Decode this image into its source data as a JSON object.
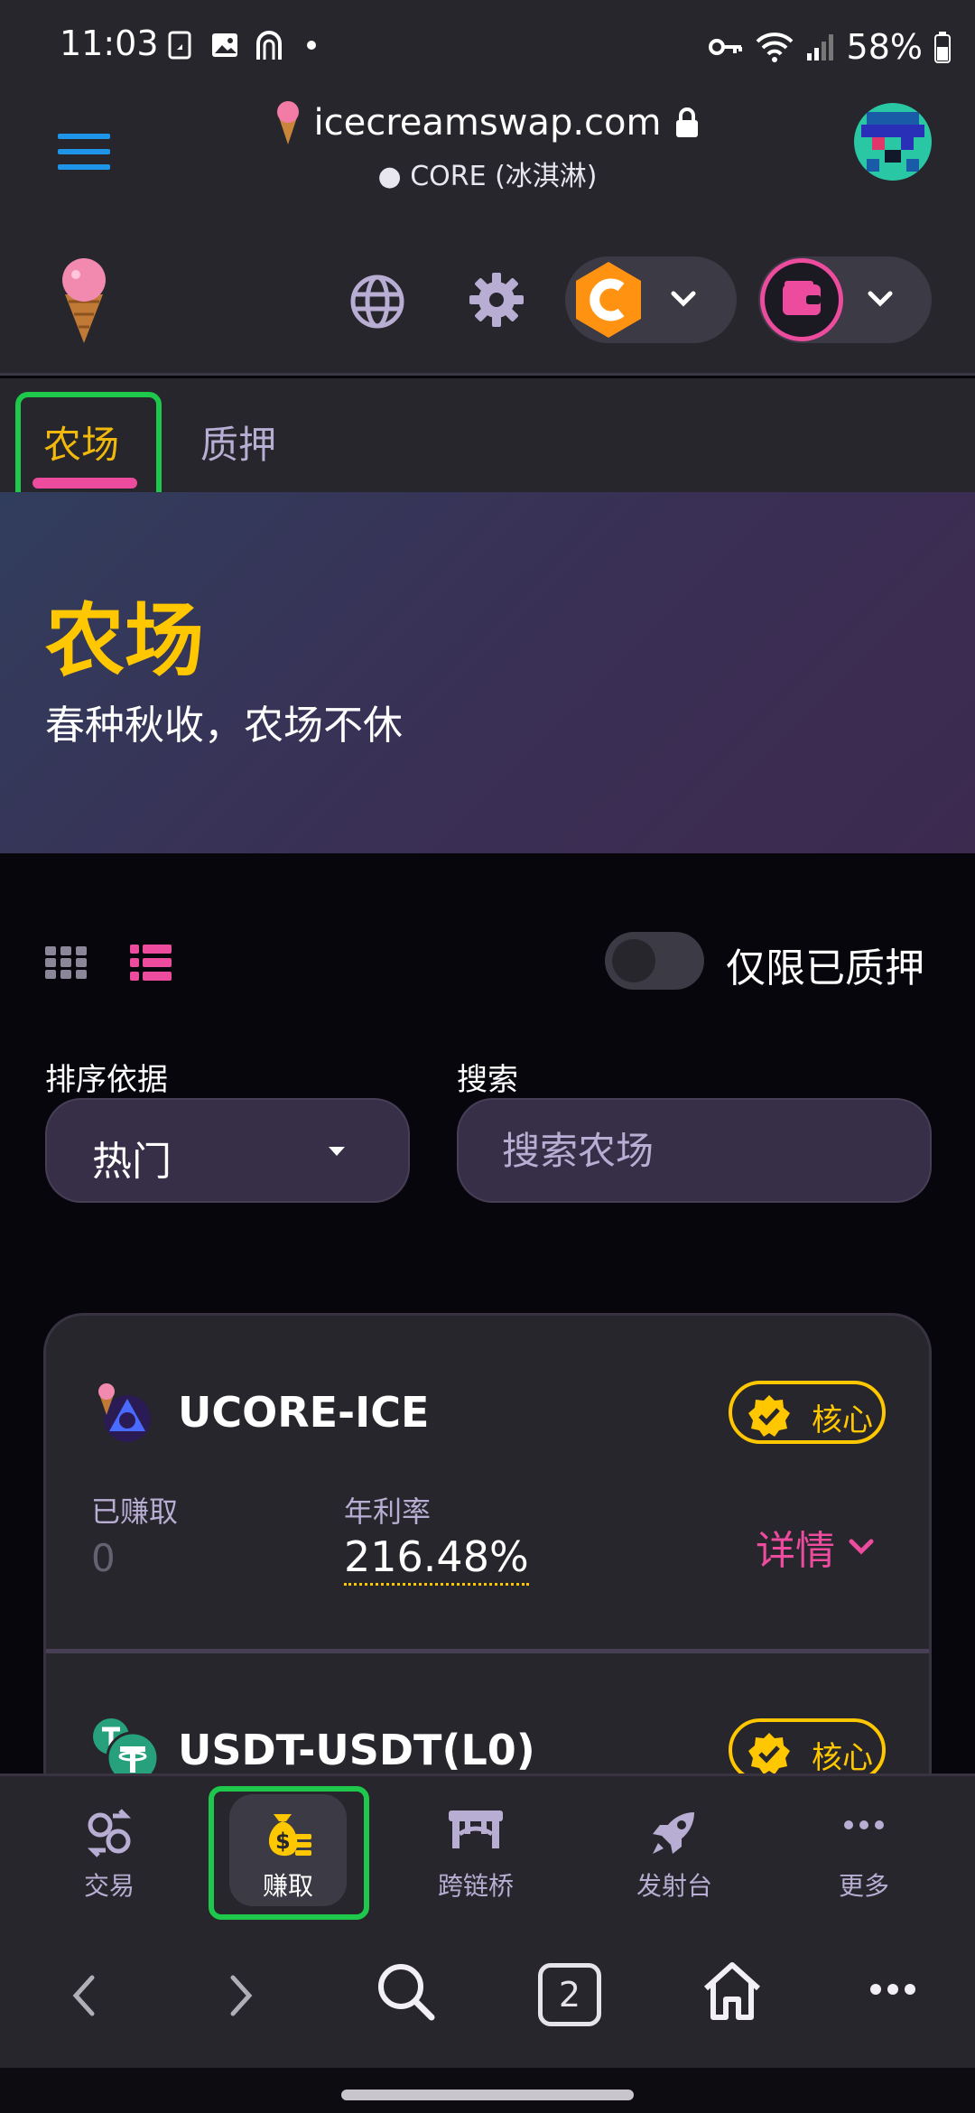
{
  "status_bar": {
    "time": "11:03",
    "battery": "58%"
  },
  "browser": {
    "url": "icecreamswap.com",
    "network": "CORE (冰淇淋)",
    "tab_count": "2"
  },
  "tabs": [
    {
      "label": "农场",
      "active": true
    },
    {
      "label": "质押",
      "active": false
    }
  ],
  "hero": {
    "title": "农场",
    "subtitle": "春种秋收，农场不休"
  },
  "filters": {
    "staked_only_label": "仅限已质押",
    "staked_only": false,
    "sort_label": "排序依据",
    "sort_value": "热门",
    "search_label": "搜索",
    "search_placeholder": "搜索农场"
  },
  "farms": [
    {
      "pair": "UCORE-ICE",
      "badge": "核心",
      "earned_label": "已赚取",
      "earned": "0",
      "apr_label": "年利率",
      "apr": "216.48%",
      "details_label": "详情"
    },
    {
      "pair": "USDT-USDT(L0)",
      "badge": "核心"
    }
  ],
  "bottom_nav": [
    {
      "label": "交易",
      "icon": "swap-icon"
    },
    {
      "label": "赚取",
      "icon": "money-bag-icon",
      "active": true
    },
    {
      "label": "跨链桥",
      "icon": "bridge-icon"
    },
    {
      "label": "发射台",
      "icon": "rocket-icon"
    },
    {
      "label": "更多",
      "icon": "more-icon"
    }
  ],
  "colors": {
    "accent_pink": "#ed4b9e",
    "accent_yellow": "#ffc700",
    "highlight_green": "#1ec84b",
    "link_blue": "#1e95e8"
  }
}
